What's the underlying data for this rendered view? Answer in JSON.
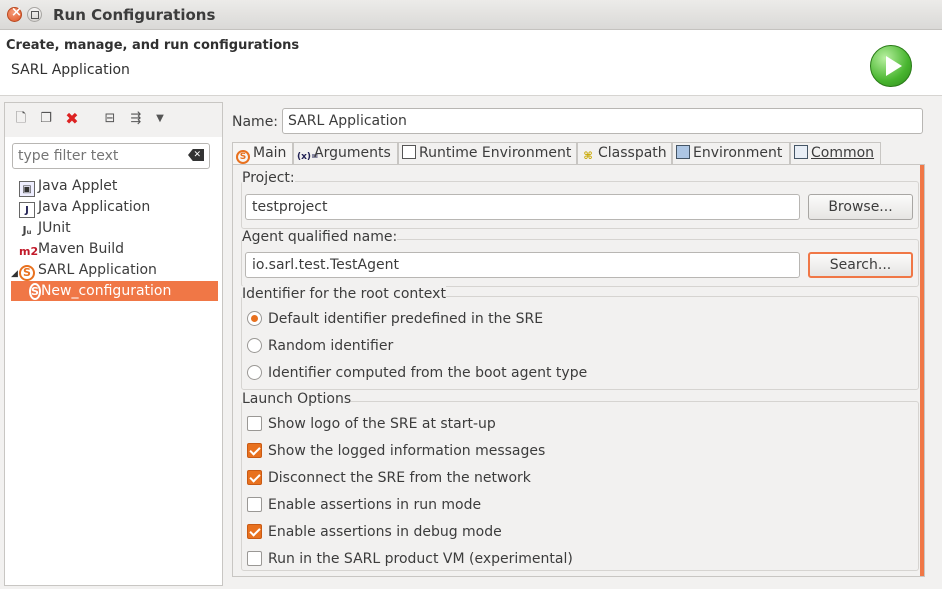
{
  "window": {
    "title": "Run Configurations"
  },
  "header": {
    "title": "Create, manage, and run configurations",
    "subtitle": "SARL Application",
    "run_icon": "run-icon"
  },
  "left_toolbar": {
    "icons": [
      "new-config-icon",
      "duplicate-icon",
      "delete-icon",
      "collapse-all-icon",
      "filter-icon",
      "dropdown-icon"
    ]
  },
  "filter": {
    "placeholder": "type filter text",
    "value": ""
  },
  "tree": {
    "items": [
      {
        "label": "Java Applet",
        "icon": "java-applet-icon"
      },
      {
        "label": "Java Application",
        "icon": "java-application-icon"
      },
      {
        "label": "JUnit",
        "icon": "junit-icon"
      },
      {
        "label": "Maven Build",
        "icon": "maven-icon"
      },
      {
        "label": "SARL Application",
        "icon": "sarl-icon",
        "expanded": true
      }
    ],
    "selected": {
      "label": "New_configuration",
      "icon": "sarl-icon"
    }
  },
  "name": {
    "label": "Name:",
    "value": "SARL Application"
  },
  "tabs": [
    {
      "label": "Main",
      "icon": "sarl-icon",
      "active": true
    },
    {
      "label": "Arguments",
      "icon": "arguments-icon"
    },
    {
      "label": "Runtime Environment",
      "icon": "runtime-icon"
    },
    {
      "label": "Classpath",
      "icon": "classpath-icon"
    },
    {
      "label": "Environment",
      "icon": "environment-icon"
    },
    {
      "label": "Common",
      "icon": "common-icon"
    }
  ],
  "main": {
    "project": {
      "label": "Project:",
      "value": "testproject",
      "button": "Browse..."
    },
    "agent": {
      "label": "Agent qualified name:",
      "value": "io.sarl.test.TestAgent",
      "button": "Search..."
    },
    "root_context": {
      "label": "Identifier for the root context",
      "options": [
        {
          "label": "Default identifier predefined in the SRE",
          "selected": true
        },
        {
          "label": "Random identifier",
          "selected": false
        },
        {
          "label": "Identifier computed from the boot agent type",
          "selected": false
        }
      ]
    },
    "launch": {
      "label": "Launch Options",
      "options": [
        {
          "label": "Show logo of the SRE at start-up",
          "checked": false
        },
        {
          "label": "Show the logged information messages",
          "checked": true
        },
        {
          "label": "Disconnect the SRE from the network",
          "checked": true
        },
        {
          "label": "Enable assertions in run mode",
          "checked": false
        },
        {
          "label": "Enable assertions in debug mode",
          "checked": true
        },
        {
          "label": "Run in the SARL product VM (experimental)",
          "checked": false
        }
      ]
    }
  },
  "colors": {
    "accent": "#f07746",
    "sarl_orange": "#e8711f",
    "run_green": "#48b52f"
  }
}
